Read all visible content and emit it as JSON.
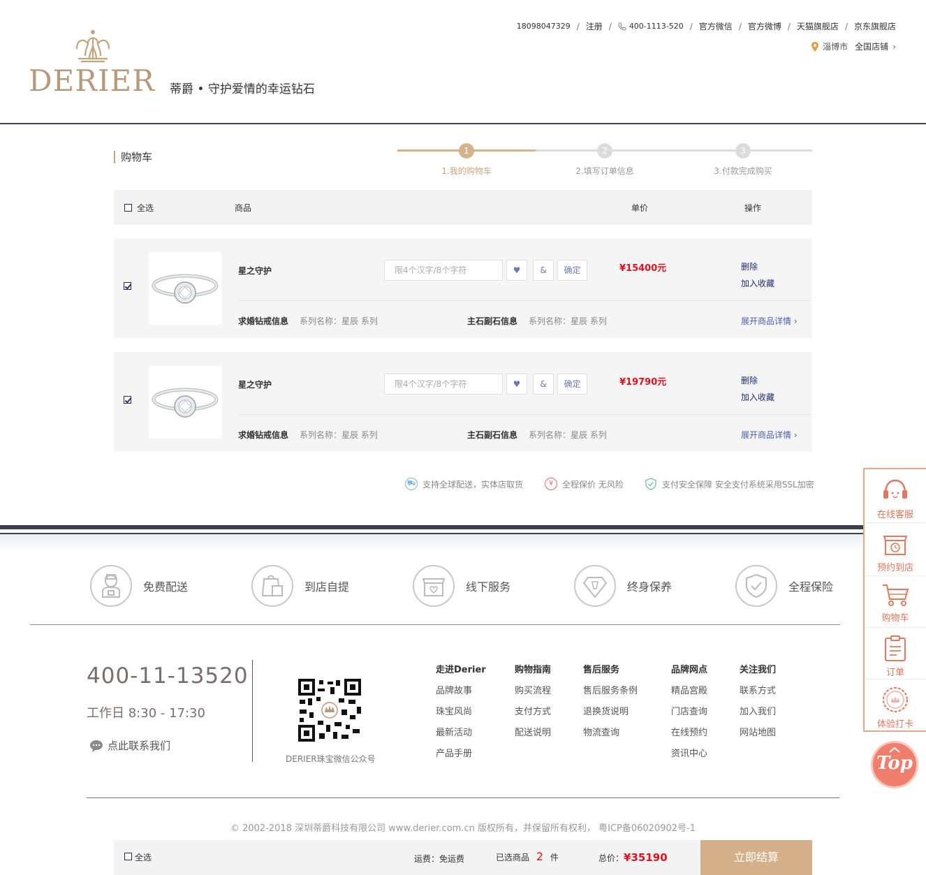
{
  "header": {
    "logo_text": "DERIER",
    "slogan": "蒂爵 • 守护爱情的幸运钻石",
    "top_links": [
      "18098047329",
      "注册",
      "400-1113-520",
      "官方微信",
      "官方微博",
      "天猫旗舰店",
      "京东旗舰店"
    ],
    "city": "淄博市",
    "all_stores": "全国店铺"
  },
  "cart": {
    "title": "购物车",
    "steps": [
      {
        "num": "1",
        "label": "1.我的购物车"
      },
      {
        "num": "2",
        "label": "2.填写订单信息"
      },
      {
        "num": "3",
        "label": "3.付款完成购买"
      }
    ],
    "table_header": {
      "select_all": "全选",
      "product": "商品",
      "unit_price": "单价",
      "action": "操作"
    },
    "items": [
      {
        "name": "星之守护",
        "engrave_placeholder": "限4个汉字/8个字符",
        "heart": "♥",
        "amp": "&",
        "confirm": "确定",
        "price": "¥15400元",
        "delete": "删除",
        "favorite": "加入收藏",
        "ring_info_label": "求婚钻戒信息",
        "ring_info_value": "系列名称：星辰 系列",
        "stone_info_label": "主石副石信息",
        "stone_info_value": "系列名称：星辰 系列",
        "expand": "展开商品详情"
      },
      {
        "name": "星之守护",
        "engrave_placeholder": "限4个汉字/8个字符",
        "heart": "♥",
        "amp": "&",
        "confirm": "确定",
        "price": "¥19790元",
        "delete": "删除",
        "favorite": "加入收藏",
        "ring_info_label": "求婚钻戒信息",
        "ring_info_value": "系列名称：星辰 系列",
        "stone_info_label": "主石副石信息",
        "stone_info_value": "系列名称：星辰 系列",
        "expand": "展开商品详情"
      }
    ],
    "guarantees": [
      "支持全球配送，实体店取货",
      "全程保价 无风险",
      "支付安全保障 安全支付系统采用SSL加密"
    ]
  },
  "services": [
    "免费配送",
    "到店自提",
    "线下服务",
    "终身保养",
    "全程保险"
  ],
  "footer": {
    "hotline": "400-11-13520",
    "hours": "工作日 8:30 - 17:30",
    "contact": "点此联系我们",
    "qr_label": "DERIER珠宝微信公众号",
    "columns": [
      {
        "title": "走进Derier",
        "links": [
          "品牌故事",
          "珠宝风尚",
          "最新活动",
          "产品手册"
        ]
      },
      {
        "title": "购物指南",
        "links": [
          "购买流程",
          "支付方式",
          "配送说明"
        ]
      },
      {
        "title": "售后服务",
        "links": [
          "售后服务条例",
          "退换货说明",
          "物流查询"
        ]
      },
      {
        "title": "品牌网点",
        "links": [
          "精品宫殿",
          "门店查询",
          "在线预约",
          "资讯中心"
        ]
      },
      {
        "title": "关注我们",
        "links": [
          "联系方式",
          "加入我们",
          "网站地图"
        ]
      }
    ],
    "copyright": "© 2002-2018 深圳蒂爵科技有限公司 www.derier.com.cn 版权所有，并保留所有权利， 粤ICP备06020902号-1"
  },
  "bottom_bar": {
    "select_all": "全选",
    "shipping": "运费：免运费",
    "selected_prefix": "已选商品",
    "selected_count": "2",
    "selected_suffix": "件",
    "total_label": "总价：",
    "total_value": "¥35190",
    "checkout": "立即结算"
  },
  "side_panel": [
    "在线客服",
    "预约到店",
    "购物车",
    "订单",
    "体验打卡"
  ],
  "top_button": "Top",
  "colors": {
    "gold": "#d3b08a",
    "price_red": "#e0101d",
    "navy": "#3a3f4d",
    "side_accent": "#d9775b"
  }
}
